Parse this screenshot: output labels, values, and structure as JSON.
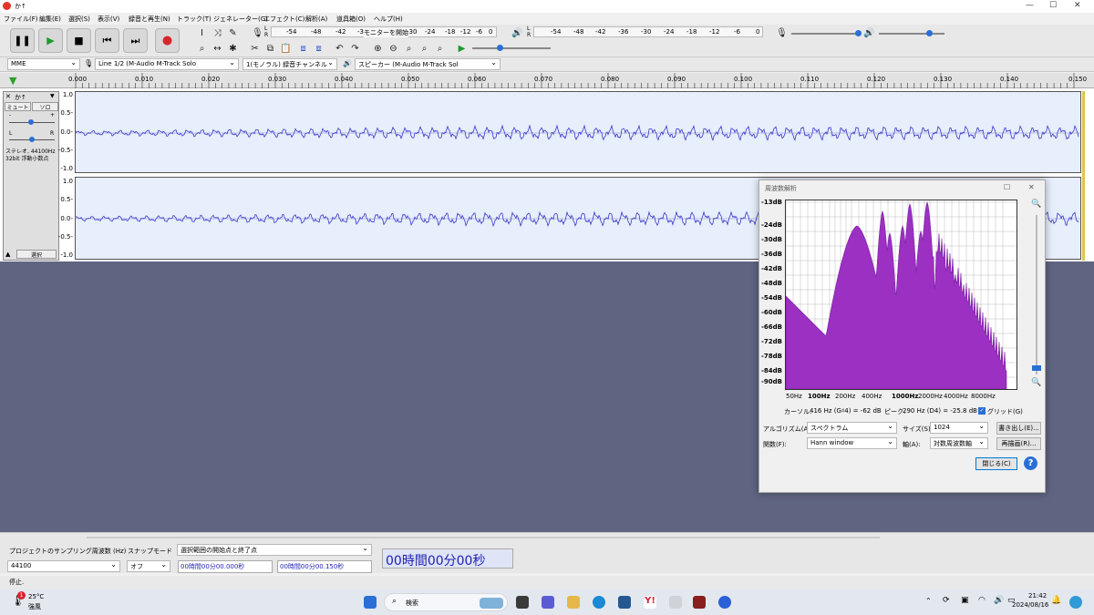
{
  "window": {
    "title": "か↑",
    "minimize": "—",
    "maximize": "☐",
    "close": "✕"
  },
  "menu": [
    "ファイル(F)",
    "編集(E)",
    "選択(S)",
    "表示(V)",
    "録音と再生(N)",
    "トラック(T)",
    "ジェネレーター(G)",
    "エフェクト(C)",
    "解析(A)",
    "道具箱(O)",
    "ヘルプ(H)"
  ],
  "meter": {
    "rec_ticks": [
      "-54",
      "-48",
      "-42",
      "-36",
      "-30",
      "-24",
      "-18",
      "-12",
      "-6",
      "0"
    ],
    "play_ticks": [
      "-54",
      "-48",
      "-42",
      "-36",
      "-30",
      "-24",
      "-18",
      "-12",
      "-6",
      "0"
    ],
    "monitor_label": "モニターを開始",
    "lr_top": "L",
    "lr_bottom": "R"
  },
  "devices": {
    "host": "MME",
    "input": "Line 1/2 (M-Audio M-Track Solo",
    "channels": "1(モノラル) 録音チャンネル",
    "output": "スピーカー (M-Audio M-Track Sol"
  },
  "ruler": [
    "0.000",
    "0.010",
    "0.020",
    "0.030",
    "0.040",
    "0.050",
    "0.060",
    "0.070",
    "0.080",
    "0.090",
    "0.100",
    "0.110",
    "0.120",
    "0.130",
    "0.140",
    "0.150"
  ],
  "track": {
    "name": "か↑",
    "mute": "ミュート",
    "solo": "ソロ",
    "gain_minus": "-",
    "gain_plus": "+",
    "pan_l": "L",
    "pan_r": "R",
    "info1": "ステレオ, 44100Hz",
    "info2": "32bit 浮動小数点",
    "select": "選択",
    "y_labels": [
      "1.0",
      "0.5-",
      "0.0-",
      "-0.5-",
      "-1.0"
    ]
  },
  "spectrum": {
    "title": "周波数解析",
    "y_labels": [
      "-13dB",
      "-24dB",
      "-30dB",
      "-36dB",
      "-42dB",
      "-48dB",
      "-54dB",
      "-60dB",
      "-66dB",
      "-72dB",
      "-78dB",
      "-84dB",
      "-90dB"
    ],
    "x_labels": [
      "50Hz",
      "100Hz",
      "200Hz",
      "400Hz",
      "1000Hz",
      "2000Hz",
      "4000Hz",
      "8000Hz"
    ],
    "cursor_label": "カーソル:",
    "cursor_value": "416 Hz (G♯4) = -62 dB",
    "peak_label": "ピーク:",
    "peak_value": "290 Hz (D4) = -25.8 dB",
    "grid_label": "グリッド(G)",
    "algorithm_label": "アルゴリズム(A):",
    "algorithm_value": "スペクトラム",
    "size_label": "サイズ(S):",
    "size_value": "1024",
    "function_label": "関数(F):",
    "function_value": "Hann window",
    "axis_label": "軸(A):",
    "axis_value": "対数周波数軸",
    "export_button": "書き出し(E)...",
    "replot_button": "再描画(R)...",
    "close_button": "閉じる(C)",
    "help_button": "?"
  },
  "selection": {
    "rate_label": "プロジェクトのサンプリング周波数 (Hz)",
    "rate_value": "44100",
    "snap_label": "スナップモード",
    "snap_value": "オフ",
    "range_label": "選択範囲の開始点と終了点",
    "start_value": "00時間00分00.000秒",
    "end_value": "00時間00分00.150秒",
    "big_time": "00時間00分00秒"
  },
  "status": "停止.",
  "taskbar": {
    "temp": "25°C",
    "weather": "強風",
    "search": "検索",
    "time": "21:42",
    "date": "2024/08/16",
    "badge": "1"
  },
  "colors": {
    "waveform": "#3a37c8",
    "spectrum": "#9b30c2",
    "accent": "#0078d4",
    "track_bg": "#e7eefc",
    "empty_bg": "#5f6480"
  }
}
